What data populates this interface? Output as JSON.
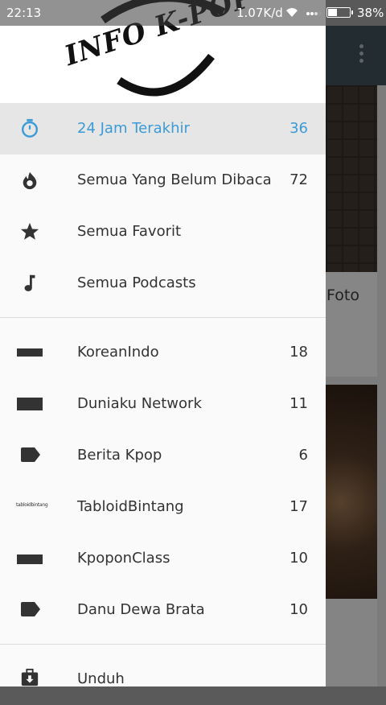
{
  "status_bar": {
    "time": "22:13",
    "net_speed": "1.07K/d",
    "battery": "38%"
  },
  "header": {
    "logo_text": "INFO K-POP"
  },
  "drawer": {
    "top_items": [
      {
        "label": "24 Jam Terakhir",
        "count": "36",
        "icon": "timer-icon",
        "active": true
      },
      {
        "label": "Semua Yang Belum Dibaca",
        "count": "72",
        "icon": "fire-icon"
      },
      {
        "label": "Semua Favorit",
        "count": "",
        "icon": "star-icon"
      },
      {
        "label": "Semua Podcasts",
        "count": "",
        "icon": "music-note-icon"
      }
    ],
    "feeds": [
      {
        "label": "KoreanIndo",
        "count": "18",
        "icon": "feed-bar-icon"
      },
      {
        "label": "Duniaku Network",
        "count": "11",
        "icon": "feed-bar-icon"
      },
      {
        "label": "Berita Kpop",
        "count": "6",
        "icon": "tag-icon"
      },
      {
        "label": "TabloidBintang",
        "count": "17",
        "icon": "tabloid-logo-icon",
        "icon_text": "tabloidbintang"
      },
      {
        "label": "KpoponClass",
        "count": "10",
        "icon": "feed-bar-icon"
      },
      {
        "label": "Danu Dewa Brata",
        "count": "10",
        "icon": "tag-icon"
      }
    ],
    "bottom_items": [
      {
        "label": "Unduh",
        "icon": "download-icon"
      }
    ]
  },
  "background": {
    "card_text": "Foto"
  },
  "colors": {
    "accent": "#3a9bd6",
    "toolbar": "#37474f",
    "active_row": "#e6e6e6"
  }
}
